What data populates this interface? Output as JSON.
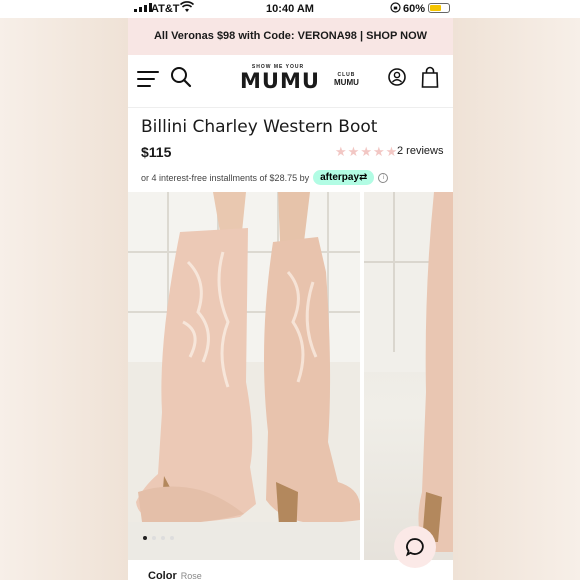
{
  "status": {
    "carrier": "AT&T",
    "time": "10:40 AM",
    "battery_pct": "60%",
    "battery_level": 0.6
  },
  "promo": {
    "text": "All Veronas $98 with Code: VERONA98 | SHOP NOW"
  },
  "header": {
    "logo_tagline": "SHOW ME YOUR",
    "logo": "MUMU",
    "club_top": "CLUB",
    "club_bottom": "MUMU"
  },
  "product": {
    "title": "Billini Charley Western Boot",
    "price": "$115",
    "rating_stars": 0,
    "reviews": "2 reviews",
    "installments": "or 4 interest-free installments of $28.75 by",
    "afterpay": "afterpay",
    "color_label": "Color",
    "color_value": "Rose"
  },
  "gallery": {
    "slide_count": 4,
    "active_slide": 1
  },
  "colors": {
    "promo_bg": "#f8e6e4",
    "star": "#f2c7c4",
    "afterpay": "#b2fce4",
    "boot": "#ecc9b6"
  }
}
